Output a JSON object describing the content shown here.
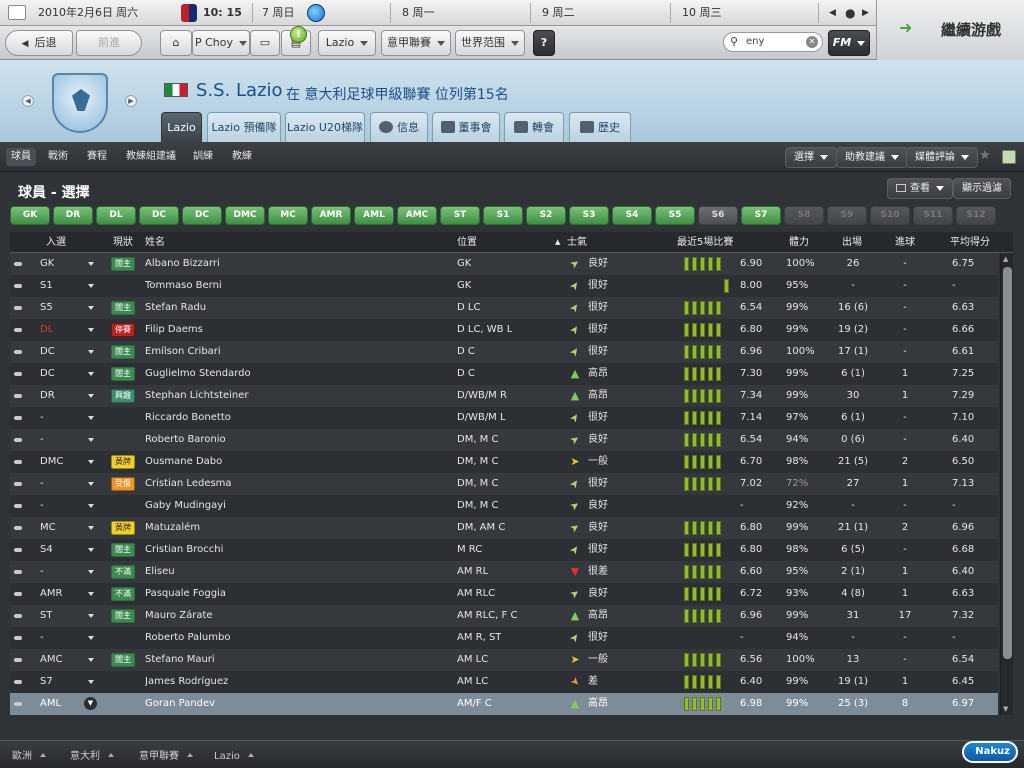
{
  "topbar": {
    "date": "2010年2月6日",
    "weekday": "周六",
    "time": "10: 15",
    "days": [
      {
        "num": "7",
        "label": "周日"
      },
      {
        "num": "8",
        "label": "周一"
      },
      {
        "num": "9",
        "label": "周二"
      },
      {
        "num": "10",
        "label": "周三"
      }
    ],
    "prev_icon": "arrow-left-icon",
    "next_icon": "arrow-right-icon"
  },
  "navbar": {
    "back": "后退",
    "forward": "前進",
    "manager": "P Choy",
    "club": "Lazio",
    "league": "意甲聯賽",
    "world": "世界范围",
    "help": "?",
    "search_value": "eny",
    "fm": "FM",
    "continue": "繼續游戲"
  },
  "header": {
    "club_name": "S.S. Lazio",
    "subtitle": "在 意大利足球甲級聯賽 位列第15名",
    "tabs": [
      "Lazio",
      "Lazio 預備隊",
      "Lazio U20梯隊",
      "信息",
      "董事會",
      "轉會",
      "歷史"
    ]
  },
  "subnav": {
    "items": [
      "球員",
      "戰術",
      "賽程",
      "教練組建議",
      "訓練",
      "教練"
    ],
    "right_buttons": [
      "選擇",
      "助教建議",
      "媒體評論"
    ]
  },
  "main": {
    "title": "球員 - 選擇",
    "view_button": "查看",
    "filter_button": "顯示過濾",
    "positions": [
      {
        "label": "GK",
        "state": "green"
      },
      {
        "label": "DR",
        "state": "green"
      },
      {
        "label": "DL",
        "state": "green"
      },
      {
        "label": "DC",
        "state": "green"
      },
      {
        "label": "DC",
        "state": "green"
      },
      {
        "label": "DMC",
        "state": "green"
      },
      {
        "label": "MC",
        "state": "green"
      },
      {
        "label": "AMR",
        "state": "green"
      },
      {
        "label": "AML",
        "state": "green"
      },
      {
        "label": "AMC",
        "state": "green"
      },
      {
        "label": "ST",
        "state": "green"
      },
      {
        "label": "S1",
        "state": "green"
      },
      {
        "label": "S2",
        "state": "green"
      },
      {
        "label": "S3",
        "state": "green"
      },
      {
        "label": "S4",
        "state": "green"
      },
      {
        "label": "S5",
        "state": "green"
      },
      {
        "label": "S6",
        "state": "gray"
      },
      {
        "label": "S7",
        "state": "green"
      },
      {
        "label": "S8",
        "state": "dim"
      },
      {
        "label": "S9",
        "state": "dim"
      },
      {
        "label": "S10",
        "state": "dim"
      },
      {
        "label": "S11",
        "state": "dim"
      },
      {
        "label": "S12",
        "state": "dim"
      }
    ],
    "columns": [
      "入選",
      "現狀",
      "姓名",
      "位置",
      "士氣",
      "最近5場比賽",
      "體力",
      "出場",
      "進球",
      "平均得分"
    ],
    "rows": [
      {
        "sel": "GK",
        "status": "闊主",
        "st": "green",
        "name": "Albano Bizzarri",
        "pos": "GK",
        "mor": "良好",
        "mi": "good",
        "form": 5,
        "last5": "6.90",
        "cond": "100%",
        "apps": "26",
        "goals": "-",
        "avg": "6.75"
      },
      {
        "sel": "S1",
        "status": "",
        "st": "",
        "name": "Tommaso Berni",
        "pos": "GK",
        "mor": "很好",
        "mi": "verygood",
        "form": 1,
        "last5": "8.00",
        "cond": "95%",
        "apps": "-",
        "goals": "-",
        "avg": "-"
      },
      {
        "sel": "S5",
        "status": "闊主",
        "st": "green",
        "name": "Stefan Radu",
        "pos": "D LC",
        "mor": "很好",
        "mi": "verygood",
        "form": 5,
        "last5": "6.54",
        "cond": "99%",
        "apps": "16 (6)",
        "goals": "-",
        "avg": "6.63"
      },
      {
        "sel": "DL",
        "selred": true,
        "status": "停賽",
        "st": "red",
        "name": "Filip Daems",
        "pos": "D LC, WB L",
        "mor": "很好",
        "mi": "verygood",
        "form": 5,
        "last5": "6.80",
        "cond": "99%",
        "apps": "19 (2)",
        "goals": "-",
        "avg": "6.66"
      },
      {
        "sel": "DC",
        "status": "闊主",
        "st": "green",
        "name": "Emílson Cribari",
        "pos": "D C",
        "mor": "很好",
        "mi": "verygood",
        "form": 5,
        "last5": "6.96",
        "cond": "100%",
        "apps": "17 (1)",
        "goals": "-",
        "avg": "6.61"
      },
      {
        "sel": "DC",
        "status": "闊主",
        "st": "green",
        "name": "Guglielmo Stendardo",
        "pos": "D C",
        "mor": "高昂",
        "mi": "superb",
        "form": 5,
        "last5": "7.30",
        "cond": "99%",
        "apps": "6 (1)",
        "goals": "1",
        "avg": "7.25"
      },
      {
        "sel": "DR",
        "status": "興趣",
        "st": "blue",
        "name": "Stephan Lichtsteiner",
        "pos": "D/WB/M R",
        "mor": "高昂",
        "mi": "superb",
        "form": 5,
        "last5": "7.34",
        "cond": "99%",
        "apps": "30",
        "goals": "1",
        "avg": "7.29"
      },
      {
        "sel": "-",
        "status": "",
        "st": "",
        "name": "Riccardo Bonetto",
        "pos": "D/WB/M L",
        "mor": "很好",
        "mi": "verygood",
        "form": 5,
        "last5": "7.14",
        "cond": "97%",
        "apps": "6 (1)",
        "goals": "-",
        "avg": "7.10"
      },
      {
        "sel": "-",
        "status": "",
        "st": "",
        "name": "Roberto Baronio",
        "pos": "DM, M C",
        "mor": "良好",
        "mi": "good",
        "form": 5,
        "last5": "6.54",
        "cond": "94%",
        "apps": "0 (6)",
        "goals": "-",
        "avg": "6.40"
      },
      {
        "sel": "DMC",
        "status": "黃牌",
        "st": "yellow",
        "name": "Ousmane Dabo",
        "pos": "DM, M C",
        "mor": "一般",
        "mi": "ok",
        "form": 5,
        "last5": "6.70",
        "cond": "98%",
        "apps": "21 (5)",
        "goals": "2",
        "avg": "6.50"
      },
      {
        "sel": "-",
        "status": "受傷",
        "st": "orange",
        "name": "Cristian Ledesma",
        "pos": "DM, M C",
        "mor": "很好",
        "mi": "verygood",
        "form": 5,
        "last5": "7.02",
        "cond": "72%",
        "condlow": true,
        "apps": "27",
        "goals": "1",
        "avg": "7.13"
      },
      {
        "sel": "-",
        "status": "",
        "st": "",
        "name": "Gaby Mudingayi",
        "pos": "DM, M C",
        "mor": "良好",
        "mi": "good",
        "form": 0,
        "last5": "-",
        "cond": "92%",
        "apps": "-",
        "goals": "-",
        "avg": "-"
      },
      {
        "sel": "MC",
        "status": "黃牌",
        "st": "yellow",
        "name": "Matuzalém",
        "pos": "DM, AM C",
        "mor": "良好",
        "mi": "good",
        "form": 5,
        "last5": "6.80",
        "cond": "99%",
        "apps": "21 (1)",
        "goals": "2",
        "avg": "6.96"
      },
      {
        "sel": "S4",
        "status": "闊主",
        "st": "green",
        "name": "Cristian Brocchi",
        "pos": "M RC",
        "mor": "很好",
        "mi": "verygood",
        "form": 5,
        "last5": "6.80",
        "cond": "98%",
        "apps": "6 (5)",
        "goals": "-",
        "avg": "6.68"
      },
      {
        "sel": "-",
        "status": "不滿",
        "st": "green",
        "name": "Eliseu",
        "pos": "AM RL",
        "mor": "很差",
        "mi": "verypoor",
        "form": 5,
        "last5": "6.60",
        "cond": "95%",
        "apps": "2 (1)",
        "goals": "1",
        "avg": "6.40"
      },
      {
        "sel": "AMR",
        "status": "不滿",
        "st": "green",
        "name": "Pasquale Foggia",
        "pos": "AM RLC",
        "mor": "良好",
        "mi": "good",
        "form": 5,
        "last5": "6.72",
        "cond": "93%",
        "apps": "4 (8)",
        "goals": "1",
        "avg": "6.63"
      },
      {
        "sel": "ST",
        "status": "闊主",
        "st": "green",
        "name": "Mauro Zárate",
        "pos": "AM RLC, F C",
        "mor": "高昂",
        "mi": "superb",
        "form": 5,
        "last5": "6.96",
        "cond": "99%",
        "apps": "31",
        "goals": "17",
        "avg": "7.32"
      },
      {
        "sel": "-",
        "status": "",
        "st": "",
        "name": "Roberto Palumbo",
        "pos": "AM R, ST",
        "mor": "很好",
        "mi": "verygood",
        "form": 0,
        "last5": "-",
        "cond": "94%",
        "apps": "-",
        "goals": "-",
        "avg": "-"
      },
      {
        "sel": "AMC",
        "status": "闊主",
        "st": "green",
        "name": "Stefano Mauri",
        "pos": "AM LC",
        "mor": "一般",
        "mi": "ok",
        "form": 5,
        "last5": "6.56",
        "cond": "100%",
        "apps": "13",
        "goals": "-",
        "avg": "6.54"
      },
      {
        "sel": "S7",
        "status": "",
        "st": "",
        "name": "James Rodríguez",
        "pos": "AM LC",
        "mor": "差",
        "mi": "poor",
        "form": 5,
        "last5": "6.40",
        "cond": "99%",
        "apps": "19 (1)",
        "goals": "1",
        "avg": "6.45"
      },
      {
        "sel": "AML",
        "status": "",
        "st": "",
        "name": "Goran Pandev",
        "pos": "AM/F C",
        "mor": "高昂",
        "mi": "superb",
        "form": 5,
        "last5": "6.98",
        "cond": "99%",
        "apps": "25 (3)",
        "goals": "8",
        "avg": "6.97",
        "selected": true
      }
    ]
  },
  "footer": {
    "breadcrumbs": [
      "歐洲",
      "意大利",
      "意甲聯賽",
      "Lazio"
    ],
    "logo": "Nakuz"
  },
  "colors": {
    "accent_green": "#3e8e44",
    "header_blue": "#1c4f88",
    "selected_row": "#7d8c97",
    "form_bar": "#93ba2b"
  }
}
